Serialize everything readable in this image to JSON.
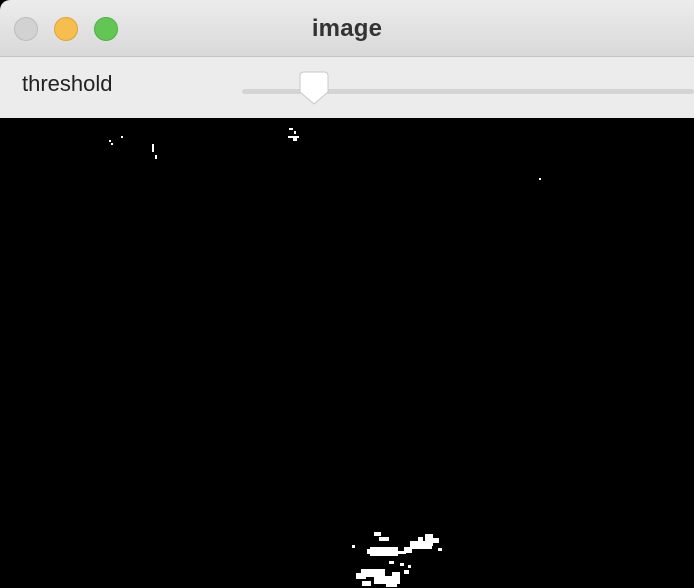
{
  "window": {
    "title": "image",
    "buttons": {
      "close": "close-button",
      "minimize": "minimize-button",
      "zoom": "zoom-button"
    }
  },
  "toolbar": {
    "threshold_label": "threshold",
    "threshold_value": 0.16
  },
  "colors": {
    "titlebar": "#e3e3e3",
    "close": "#d2d2d2",
    "minimize": "#f6bd4f",
    "zoom": "#62c655",
    "canvas_background": "#000000",
    "foreground_pixels": "#ffffff"
  },
  "icons": {
    "close": "close-icon",
    "minimize": "minimize-icon",
    "zoom": "zoom-icon"
  }
}
